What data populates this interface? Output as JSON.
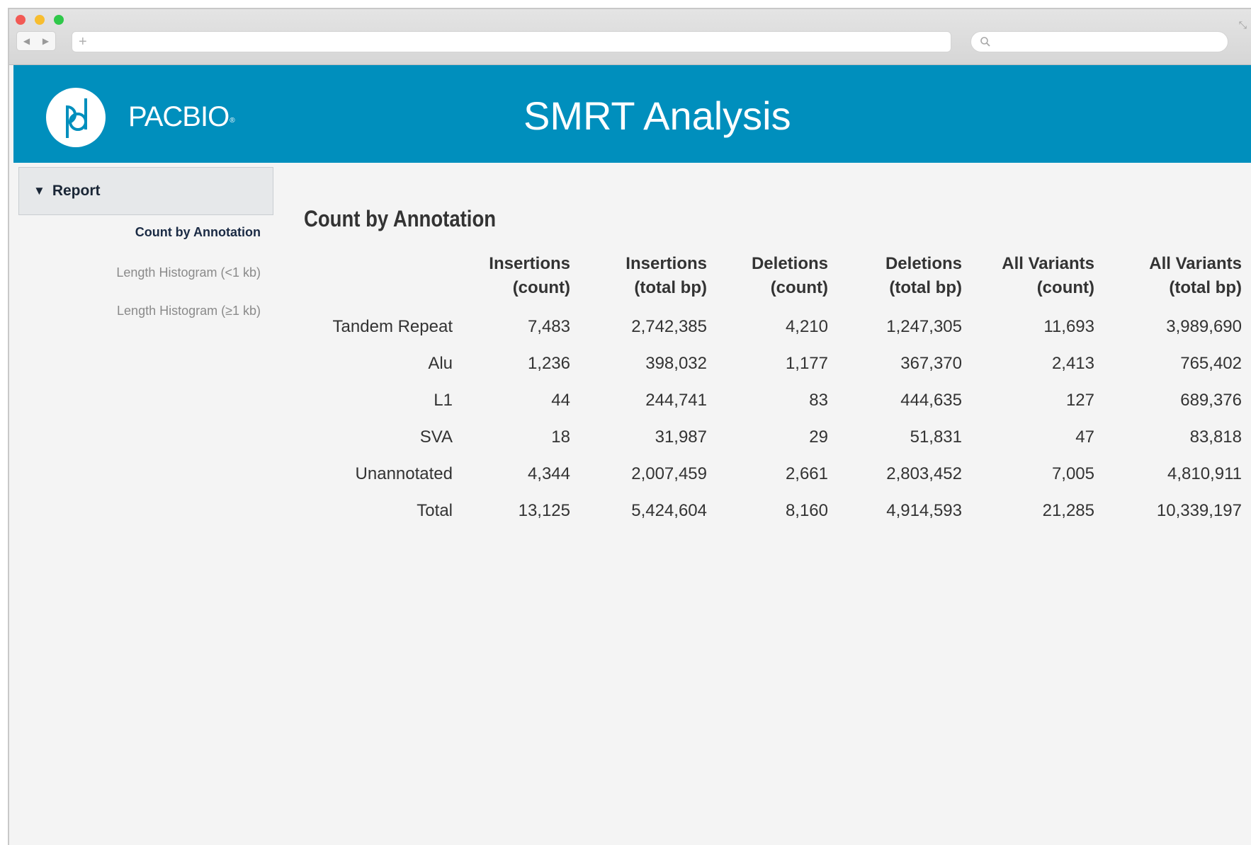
{
  "header": {
    "brand": "PACBIO",
    "brand_mark": "®",
    "title": "SMRT Analysis"
  },
  "sidebar": {
    "section_label": "Report",
    "items": [
      {
        "label": "Count by Annotation",
        "active": true
      },
      {
        "label": "Length Histogram (<1 kb)",
        "active": false
      },
      {
        "label": "Length Histogram (≥1 kb)",
        "active": false
      }
    ]
  },
  "main": {
    "title": "Count by Annotation",
    "table": {
      "columns": [
        {
          "line1": "Insertions",
          "line2": "(count)"
        },
        {
          "line1": "Insertions",
          "line2": "(total bp)"
        },
        {
          "line1": "Deletions",
          "line2": "(count)"
        },
        {
          "line1": "Deletions",
          "line2": "(total bp)"
        },
        {
          "line1": "All Variants",
          "line2": "(count)"
        },
        {
          "line1": "All Variants",
          "line2": "(total bp)"
        }
      ],
      "rows": [
        {
          "label": "Tandem Repeat",
          "cells": [
            "7,483",
            "2,742,385",
            "4,210",
            "1,247,305",
            "11,693",
            "3,989,690"
          ]
        },
        {
          "label": "Alu",
          "cells": [
            "1,236",
            "398,032",
            "1,177",
            "367,370",
            "2,413",
            "765,402"
          ]
        },
        {
          "label": "L1",
          "cells": [
            "44",
            "244,741",
            "83",
            "444,635",
            "127",
            "689,376"
          ]
        },
        {
          "label": "SVA",
          "cells": [
            "18",
            "31,987",
            "29",
            "51,831",
            "47",
            "83,818"
          ]
        },
        {
          "label": "Unannotated",
          "cells": [
            "4,344",
            "2,007,459",
            "2,661",
            "2,803,452",
            "7,005",
            "4,810,911"
          ]
        },
        {
          "label": "Total",
          "cells": [
            "13,125",
            "5,424,604",
            "8,160",
            "4,914,593",
            "21,285",
            "10,339,197"
          ]
        }
      ]
    }
  },
  "colors": {
    "header_bg": "#008fbd",
    "page_bg": "#f4f4f4",
    "sidebar_header_bg": "#e6e8ea"
  },
  "icons": [
    "close-dot-icon",
    "minimize-dot-icon",
    "zoom-dot-icon",
    "back-arrow-icon",
    "forward-arrow-icon",
    "new-tab-plus-icon",
    "search-icon",
    "pacbio-logo-icon",
    "disclosure-triangle-icon"
  ]
}
